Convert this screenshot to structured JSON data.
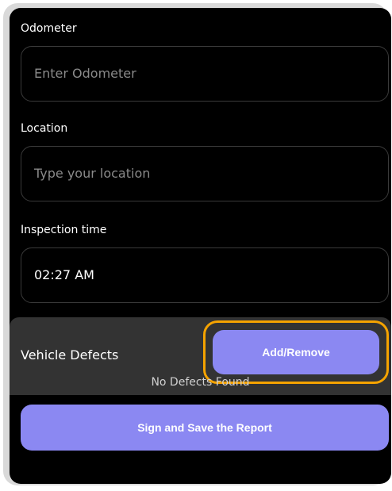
{
  "form": {
    "odometer": {
      "label": "Odometer",
      "placeholder": "Enter Odometer"
    },
    "location": {
      "label": "Location",
      "placeholder": "Type your location"
    },
    "inspection_time": {
      "label": "Inspection time",
      "value": "02:27 AM"
    }
  },
  "defects": {
    "title": "Vehicle Defects",
    "add_remove_label": "Add/Remove",
    "status_text": "No Defects Found"
  },
  "actions": {
    "sign_save_label": "Sign and Save the Report"
  },
  "colors": {
    "accent": "#8b88f2",
    "highlight": "#f5a300",
    "panel": "#333333",
    "background": "#000000"
  }
}
